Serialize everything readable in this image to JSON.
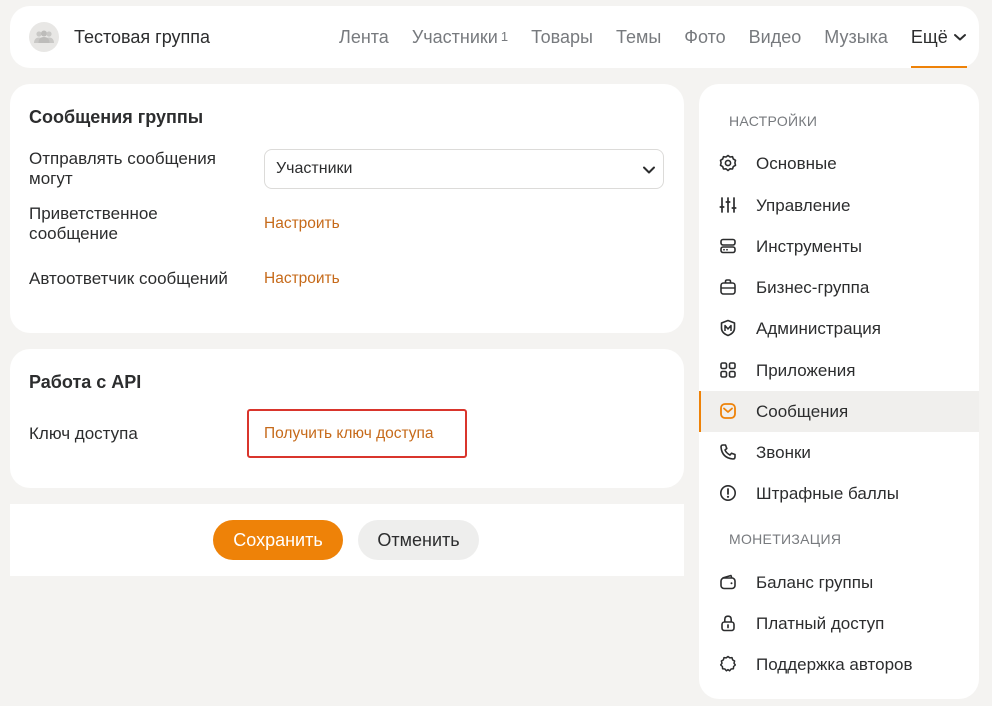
{
  "header": {
    "group_name": "Тестовая группа",
    "nav": [
      {
        "label": "Лента"
      },
      {
        "label": "Участники",
        "count": "1"
      },
      {
        "label": "Товары"
      },
      {
        "label": "Темы"
      },
      {
        "label": "Фото"
      },
      {
        "label": "Видео"
      },
      {
        "label": "Музыка"
      }
    ],
    "more_label": "Ещё"
  },
  "messages_card": {
    "title": "Сообщения группы",
    "who_can_send_label": "Отправлять сообщения могут",
    "who_can_send_value": "Участники",
    "welcome_label": "Приветственное сообщение",
    "welcome_link": "Настроить",
    "autoreply_label": "Автоответчик сообщений",
    "autoreply_link": "Настроить"
  },
  "api_card": {
    "title": "Работа с API",
    "key_label": "Ключ доступа",
    "key_link": "Получить ключ доступа"
  },
  "actions": {
    "save_label": "Сохранить",
    "cancel_label": "Отменить"
  },
  "sidebar": {
    "settings_title": "НАСТРОЙКИ",
    "settings_items": [
      {
        "label": "Основные",
        "icon": "gear-icon"
      },
      {
        "label": "Управление",
        "icon": "sliders-icon"
      },
      {
        "label": "Инструменты",
        "icon": "tools-icon"
      },
      {
        "label": "Бизнес-группа",
        "icon": "briefcase-icon"
      },
      {
        "label": "Администрация",
        "icon": "admin-shield-icon"
      },
      {
        "label": "Приложения",
        "icon": "apps-grid-icon"
      },
      {
        "label": "Сообщения",
        "icon": "envelope-icon",
        "active": true
      },
      {
        "label": "Звонки",
        "icon": "phone-icon"
      },
      {
        "label": "Штрафные баллы",
        "icon": "warning-circle-icon"
      }
    ],
    "monetization_title": "МОНЕТИЗАЦИЯ",
    "monetization_items": [
      {
        "label": "Баланс группы",
        "icon": "wallet-icon"
      },
      {
        "label": "Платный доступ",
        "icon": "lock-icon"
      },
      {
        "label": "Поддержка авторов",
        "icon": "badge-icon"
      }
    ]
  },
  "colors": {
    "accent": "#ee8208",
    "link": "#c66a1a",
    "highlight_border": "#d9352c",
    "page_bg": "#f4f3f1"
  }
}
